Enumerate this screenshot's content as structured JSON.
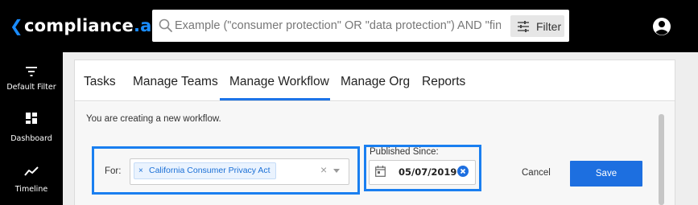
{
  "app": {
    "logo_main": "compliance",
    "logo_suffix": ".ai"
  },
  "search": {
    "placeholder": "Example (\"consumer protection\" OR \"data protection\") AND \"financial i...",
    "value": "",
    "icon": "search-icon",
    "filter_label": "Filter"
  },
  "header": {
    "account_icon": "account-circle-icon"
  },
  "sidebar": {
    "items": [
      {
        "label": "Default Filter",
        "icon": "filter-lines-icon"
      },
      {
        "label": "Dashboard",
        "icon": "dashboard-grid-icon"
      },
      {
        "label": "Timeline",
        "icon": "trend-line-icon"
      }
    ]
  },
  "tabs": [
    {
      "label": "Tasks",
      "active": false
    },
    {
      "label": "Manage Teams",
      "active": false
    },
    {
      "label": "Manage Workflow",
      "active": true
    },
    {
      "label": "Manage Org",
      "active": false
    },
    {
      "label": "Reports",
      "active": false
    }
  ],
  "workflow": {
    "notice": "You are creating a new workflow.",
    "for_label": "For:",
    "for_selected": [
      "California Consumer Privacy Act"
    ],
    "published_since_label": "Published Since:",
    "published_since_value": "05/07/2019",
    "cancel_label": "Cancel",
    "save_label": "Save"
  },
  "colors": {
    "brand_accent": "#1a8cff",
    "highlight_border": "#1a7ff0",
    "primary_button": "#1d6fe0",
    "topbar": "#000000"
  }
}
